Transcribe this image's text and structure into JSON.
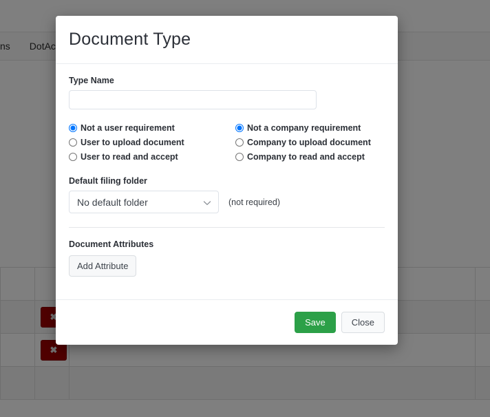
{
  "background": {
    "navbar": {
      "items": [
        {
          "label": "ns"
        },
        {
          "label": "DotActi"
        }
      ]
    },
    "table": {
      "rows": [
        {
          "cells": [
            "",
            "",
            "",
            ""
          ],
          "striped": false,
          "delete_label": ""
        },
        {
          "cells": [
            "",
            "✖",
            "",
            ""
          ],
          "striped": true,
          "delete_label": "✖"
        },
        {
          "cells": [
            "",
            "✖",
            "",
            ""
          ],
          "striped": false,
          "delete_label": "✖"
        },
        {
          "cells": [
            "",
            "",
            "",
            ""
          ],
          "striped": true,
          "delete_label": ""
        }
      ]
    }
  },
  "modal": {
    "title": "Document Type",
    "type_name": {
      "label": "Type Name",
      "value": "",
      "placeholder": ""
    },
    "user_requirement": {
      "options": [
        {
          "label": "Not a user requirement",
          "selected": true
        },
        {
          "label": "User to upload document",
          "selected": false
        },
        {
          "label": "User to read and accept",
          "selected": false
        }
      ]
    },
    "company_requirement": {
      "options": [
        {
          "label": "Not a company requirement",
          "selected": true
        },
        {
          "label": "Company to upload document",
          "selected": false
        },
        {
          "label": "Company to read and accept",
          "selected": false
        }
      ]
    },
    "default_folder": {
      "label": "Default filing folder",
      "selected": "No default folder",
      "hint": "(not required)"
    },
    "attributes": {
      "title": "Document Attributes",
      "add_label": "Add Attribute"
    },
    "footer": {
      "save_label": "Save",
      "close_label": "Close"
    }
  },
  "colors": {
    "save_green": "#2ca048",
    "delete_red": "#a00000",
    "title_text": "#2c3038"
  }
}
